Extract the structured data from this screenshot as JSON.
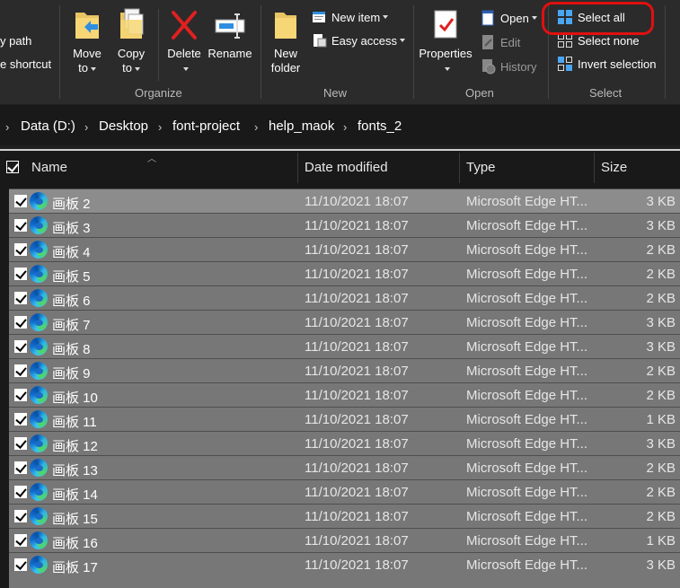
{
  "ribbon": {
    "clipboard_partial": {
      "copy_path": "y path",
      "paste_shortcut": "e shortcut"
    },
    "organize": {
      "label": "Organize",
      "move_to": [
        "Move",
        "to"
      ],
      "copy_to": [
        "Copy",
        "to"
      ],
      "delete": "Delete",
      "rename": "Rename"
    },
    "new": {
      "label": "New",
      "new_folder": [
        "New",
        "folder"
      ],
      "new_item": "New item",
      "easy_access": "Easy access"
    },
    "open": {
      "label": "Open",
      "properties": "Properties",
      "open": "Open",
      "edit": "Edit",
      "history": "History"
    },
    "select": {
      "label": "Select",
      "select_all": "Select all",
      "select_none": "Select none",
      "invert_selection": "Invert selection"
    }
  },
  "breadcrumb": [
    "Data (D:)",
    "Desktop",
    "font-project",
    "help_maok",
    "fonts_2"
  ],
  "columns": {
    "name": "Name",
    "date": "Date modified",
    "type": "Type",
    "size": "Size"
  },
  "files": [
    {
      "name": "画板 2",
      "date": "11/10/2021 18:07",
      "type": "Microsoft Edge HT...",
      "size": "3 KB"
    },
    {
      "name": "画板 3",
      "date": "11/10/2021 18:07",
      "type": "Microsoft Edge HT...",
      "size": "3 KB"
    },
    {
      "name": "画板 4",
      "date": "11/10/2021 18:07",
      "type": "Microsoft Edge HT...",
      "size": "2 KB"
    },
    {
      "name": "画板 5",
      "date": "11/10/2021 18:07",
      "type": "Microsoft Edge HT...",
      "size": "2 KB"
    },
    {
      "name": "画板 6",
      "date": "11/10/2021 18:07",
      "type": "Microsoft Edge HT...",
      "size": "2 KB"
    },
    {
      "name": "画板 7",
      "date": "11/10/2021 18:07",
      "type": "Microsoft Edge HT...",
      "size": "3 KB"
    },
    {
      "name": "画板 8",
      "date": "11/10/2021 18:07",
      "type": "Microsoft Edge HT...",
      "size": "3 KB"
    },
    {
      "name": "画板 9",
      "date": "11/10/2021 18:07",
      "type": "Microsoft Edge HT...",
      "size": "2 KB"
    },
    {
      "name": "画板 10",
      "date": "11/10/2021 18:07",
      "type": "Microsoft Edge HT...",
      "size": "2 KB"
    },
    {
      "name": "画板 11",
      "date": "11/10/2021 18:07",
      "type": "Microsoft Edge HT...",
      "size": "1 KB"
    },
    {
      "name": "画板 12",
      "date": "11/10/2021 18:07",
      "type": "Microsoft Edge HT...",
      "size": "3 KB"
    },
    {
      "name": "画板 13",
      "date": "11/10/2021 18:07",
      "type": "Microsoft Edge HT...",
      "size": "2 KB"
    },
    {
      "name": "画板 14",
      "date": "11/10/2021 18:07",
      "type": "Microsoft Edge HT...",
      "size": "2 KB"
    },
    {
      "name": "画板 15",
      "date": "11/10/2021 18:07",
      "type": "Microsoft Edge HT...",
      "size": "2 KB"
    },
    {
      "name": "画板 16",
      "date": "11/10/2021 18:07",
      "type": "Microsoft Edge HT...",
      "size": "1 KB"
    },
    {
      "name": "画板 17",
      "date": "11/10/2021 18:07",
      "type": "Microsoft Edge HT...",
      "size": "3 KB"
    }
  ],
  "colors": {
    "highlight_ring": "#e01010",
    "selected_row": "#777777",
    "ribbon_bg": "#2b2b2b"
  },
  "icons": [
    "edge-html-file-icon",
    "move-to-icon",
    "copy-to-icon",
    "delete-icon",
    "rename-icon",
    "new-folder-icon",
    "new-item-icon",
    "easy-access-icon",
    "properties-icon",
    "open-icon",
    "edit-icon",
    "history-icon",
    "select-all-icon",
    "select-none-icon",
    "invert-selection-icon"
  ]
}
